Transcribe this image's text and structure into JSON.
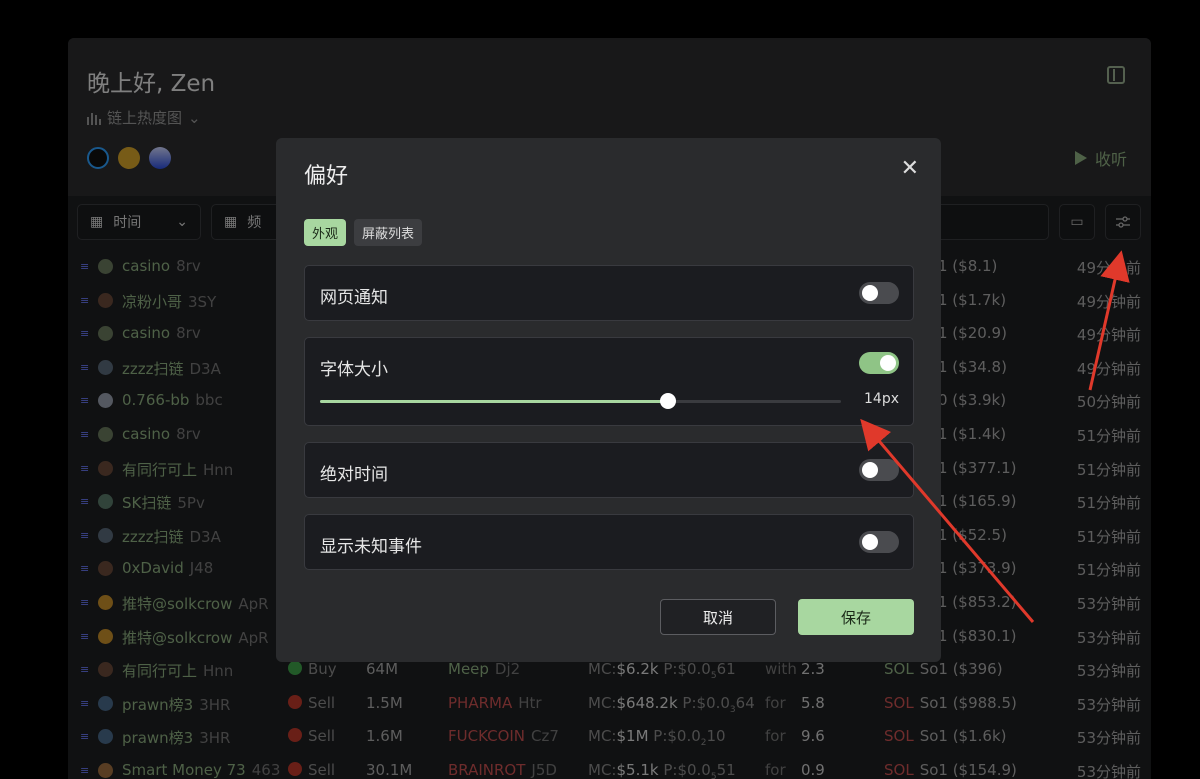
{
  "header": {
    "greeting": "晚上好, Zen",
    "view_label": "链上热度图",
    "listen_label": "收听"
  },
  "filters": {
    "time_label": "时间",
    "freq_label": "频"
  },
  "rows": [
    {
      "av": "#6b7b5e",
      "name": "casino",
      "short": "8rv",
      "sol_rest": "1 ($8.1)",
      "time": "49分钟前"
    },
    {
      "av": "#6b4a3a",
      "name": "凉粉小哥",
      "short": "3SY",
      "sol_rest": "1 ($1.7k)",
      "time": "49分钟前"
    },
    {
      "av": "#6b7b5e",
      "name": "casino",
      "short": "8rv",
      "sol_rest": "1 ($20.9)",
      "time": "49分钟前"
    },
    {
      "av": "#5a6b7b",
      "name": "zzzz扫链",
      "short": "D3A",
      "sol_rest": "1 ($34.8)",
      "time": "49分钟前"
    },
    {
      "av": "#9aa0b0",
      "name": "0.766-bb",
      "short": "bbc",
      "sol_rest": "0 ($3.9k)",
      "time": "50分钟前"
    },
    {
      "av": "#6b7b5e",
      "name": "casino",
      "short": "8rv",
      "sol_rest": "1 ($1.4k)",
      "time": "51分钟前"
    },
    {
      "av": "#6b4a3a",
      "name": "有同行可上",
      "short": "Hnn",
      "sol_rest": "1 ($377.1)",
      "time": "51分钟前"
    },
    {
      "av": "#5a7b6b",
      "name": "SK扫链",
      "short": "5Pv",
      "sol_rest": "1 ($165.9)",
      "time": "51分钟前"
    },
    {
      "av": "#5a6b7b",
      "name": "zzzz扫链",
      "short": "D3A",
      "sol_rest": "1 ($52.5)",
      "time": "51分钟前"
    },
    {
      "av": "#6b4a3a",
      "name": "0xDavid",
      "short": "J48",
      "sol_rest": "1 ($373.9)",
      "time": "51分钟前"
    },
    {
      "av": "#c8902a",
      "name": "推特@solkcrow",
      "short": "ApR",
      "sol_rest": "1 ($853.2)",
      "time": "53分钟前"
    },
    {
      "av": "#c8902a",
      "name": "推特@solkcrow",
      "short": "ApR",
      "sol_rest": "1 ($830.1)",
      "time": "53分钟前"
    }
  ],
  "full_rows": [
    {
      "av": "#6b4a3a",
      "name": "有同行可上",
      "short": "Hnn",
      "act": "Buy",
      "act_color": "#3fa34a",
      "amt": "64M",
      "tok": "Meep",
      "tok_short": "Dj2",
      "tok_green": true,
      "mc": "$6.2k",
      "p": "$0.0",
      "psub": "5",
      "ptail": "61",
      "forv": "with",
      "val": "2.3",
      "sol": "SOL",
      "sol_green": true,
      "sol_rest": "So1 ($396)",
      "time": "53分钟前"
    },
    {
      "av": "#4a6b8b",
      "name": "prawn榜3",
      "short": "3HR",
      "act": "Sell",
      "act_color": "#c0392b",
      "amt": "1.5M",
      "tok": "PHARMA",
      "tok_short": "Htr",
      "tok_green": false,
      "mc": "$648.2k",
      "p": "$0.0",
      "psub": "3",
      "ptail": "64",
      "forv": "for",
      "val": "5.8",
      "sol": "SOL",
      "sol_green": false,
      "sol_rest": "So1 ($988.5)",
      "time": "53分钟前"
    },
    {
      "av": "#4a6b8b",
      "name": "prawn榜3",
      "short": "3HR",
      "act": "Sell",
      "act_color": "#c0392b",
      "amt": "1.6M",
      "tok": "FUCKCOIN",
      "tok_short": "Cz7",
      "tok_green": false,
      "mc": "$1M",
      "p": "$0.0",
      "psub": "2",
      "ptail": "10",
      "forv": "for",
      "val": "9.6",
      "sol": "SOL",
      "sol_green": false,
      "sol_rest": "So1 ($1.6k)",
      "time": "53分钟前"
    },
    {
      "av": "#a07040",
      "name": "Smart Money 73",
      "short": "463",
      "act": "Sell",
      "act_color": "#c0392b",
      "amt": "30.1M",
      "tok": "BRAINROT",
      "tok_short": "J5D",
      "tok_green": false,
      "mc": "$5.1k",
      "p": "$0.0",
      "psub": "5",
      "ptail": "51",
      "forv": "for",
      "val": "0.9",
      "sol": "SOL",
      "sol_green": false,
      "sol_rest": "So1 ($154.9)",
      "time": "53分钟前"
    }
  ],
  "mc_label": "MC:",
  "p_label": "P:",
  "modal": {
    "title": "偏好",
    "close": "✕",
    "tabs": [
      "外观",
      "屏蔽列表"
    ],
    "web_notify": "网页通知",
    "font_size": "字体大小",
    "font_size_value": "14px",
    "font_size_fraction": 0.667,
    "absolute_time": "绝对时间",
    "show_unknown": "显示未知事件",
    "cancel": "取消",
    "save": "保存"
  }
}
